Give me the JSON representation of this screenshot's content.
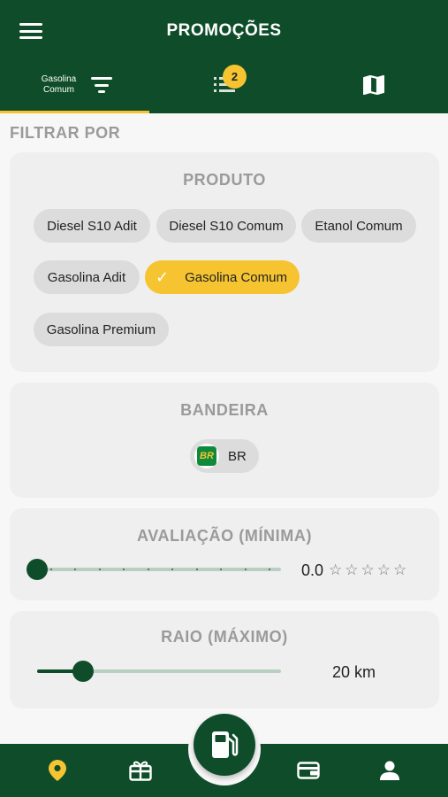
{
  "header": {
    "title": "PROMOÇÕES"
  },
  "tabs": {
    "filter_label": "Gasolina Comum",
    "list_badge": "2"
  },
  "filter_heading": "FILTRAR POR",
  "produto": {
    "title": "PRODUTO",
    "chips": [
      "Diesel S10 Adit",
      "Diesel S10 Comum",
      "Etanol Comum",
      "Gasolina Adit",
      "Gasolina Comum",
      "Gasolina Premium"
    ],
    "selected": "Gasolina Comum"
  },
  "bandeira": {
    "title": "BANDEIRA",
    "logo_text": "BR",
    "label": "BR"
  },
  "avaliacao": {
    "title": "AVALIAÇÃO (MÍNIMA)",
    "value_text": "0.0",
    "value": 0,
    "max": 5
  },
  "raio": {
    "title": "RAIO (MÁXIMO)",
    "value_text": "20 km",
    "fraction": 0.19
  },
  "colors": {
    "primary": "#0f4d2a",
    "accent": "#f6c431",
    "chip": "#dcdcdc",
    "card": "#efefef"
  },
  "icons": {
    "menu": "menu-icon",
    "filter": "filter-icon",
    "list": "list-icon",
    "map": "map-icon",
    "fuel": "fuel-pump-icon",
    "location": "location-pin-icon",
    "gift": "gift-icon",
    "wallet": "wallet-icon",
    "profile": "person-icon"
  }
}
